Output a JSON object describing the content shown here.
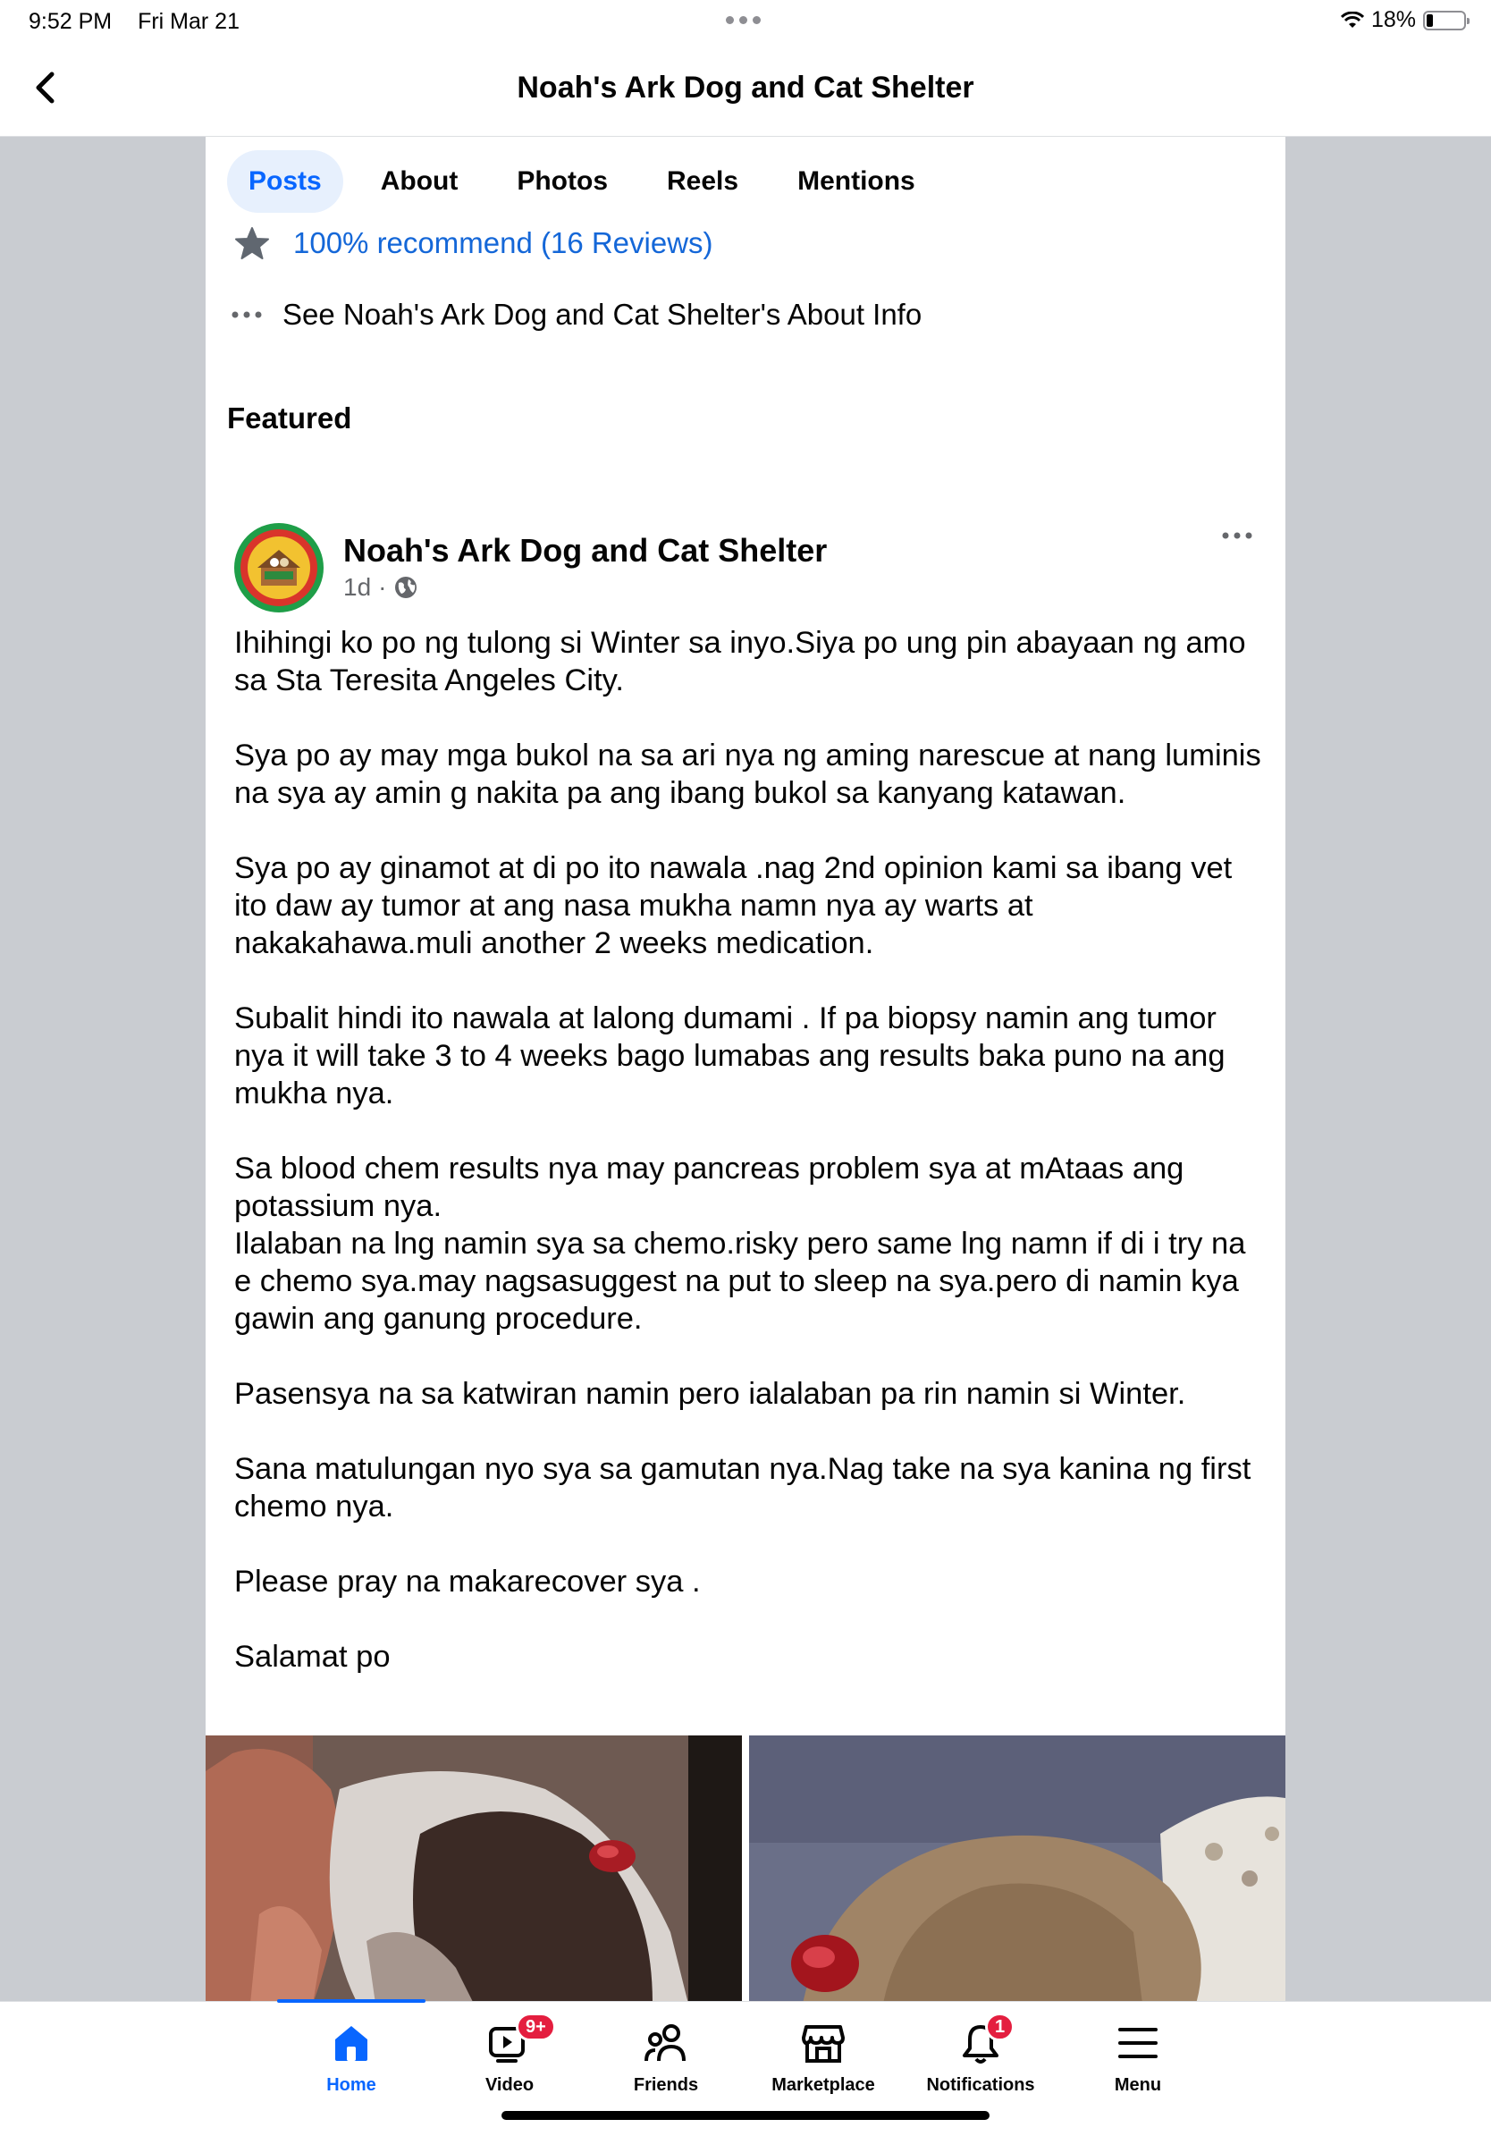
{
  "status_bar": {
    "time": "9:52 PM",
    "date": "Fri Mar 21",
    "battery": "18%",
    "battery_level": 0.18
  },
  "header": {
    "title": "Noah's Ark Dog and Cat Shelter"
  },
  "tabs": [
    {
      "label": "Posts",
      "active": true
    },
    {
      "label": "About"
    },
    {
      "label": "Photos"
    },
    {
      "label": "Reels"
    },
    {
      "label": "Mentions"
    }
  ],
  "reviews": {
    "text": "100% recommend (16 Reviews)"
  },
  "about_link": {
    "text": "See Noah's Ark Dog and Cat Shelter's About Info"
  },
  "featured": {
    "heading": "Featured"
  },
  "post": {
    "author": "Noah's Ark Dog and Cat Shelter",
    "time": "1d",
    "privacy_icon": "globe-icon",
    "paragraphs": [
      "Ihihingi ko po ng tulong si Winter sa inyo.Siya po ung pin abayaan ng amo sa Sta Teresita Angeles City.",
      "Sya po ay may mga bukol na sa ari nya ng aming narescue at nang luminis na sya ay amin g nakita pa ang ibang bukol sa kanyang katawan.",
      "Sya po ay ginamot at di po ito nawala .nag 2nd opinion kami sa ibang vet ito daw ay tumor at ang nasa mukha namn nya ay warts  at nakakahawa.muli another 2 weeks medication.",
      "Subalit hindi ito nawala at lalong dumami . If pa biopsy namin ang tumor nya it will take 3 to 4 weeks bago lumabas ang results baka puno na ang mukha nya.",
      "Sa blood chem results nya may pancreas problem sya at mAtaas ang potassium nya.\nIlalaban na lng namin sya sa chemo.risky pero same lng namn if di i try na e chemo sya.may nagsasuggest na put to sleep na sya.pero di namin kya gawin ang ganung procedure.",
      "Pasensya na sa katwiran namin pero ialalaban pa rin namin si Winter.",
      "Sana matulungan nyo sya sa gamutan nya.Nag take na sya kanina ng first chemo nya.",
      "Please pray na makarecover sya .",
      "Salamat po"
    ]
  },
  "bottom_nav": {
    "items": [
      {
        "label": "Home",
        "active": true
      },
      {
        "label": "Video",
        "badge": "9+"
      },
      {
        "label": "Friends"
      },
      {
        "label": "Marketplace"
      },
      {
        "label": "Notifications",
        "badge": "1"
      },
      {
        "label": "Menu"
      }
    ]
  },
  "colors": {
    "accent": "#0866ff",
    "link": "#1467d8",
    "side_bg": "#c9ccd1",
    "badge": "#e41e3f"
  }
}
